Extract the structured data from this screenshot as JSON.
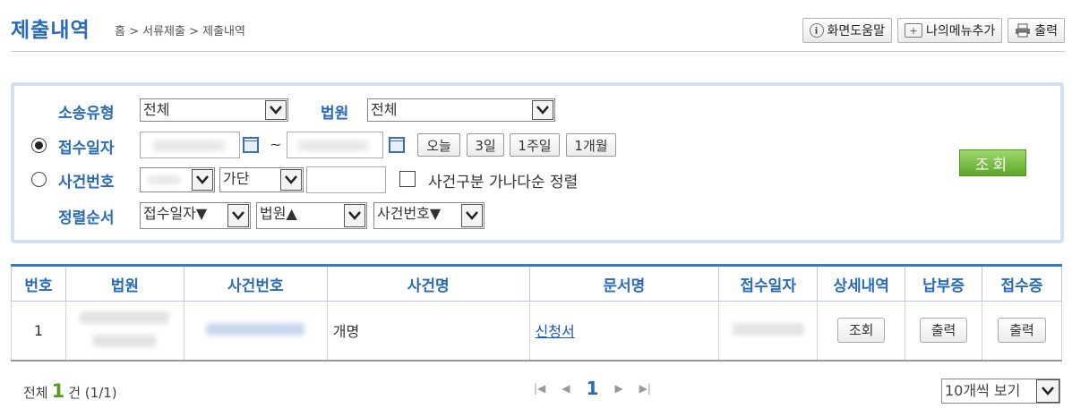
{
  "header": {
    "title": "제출내역",
    "breadcrumb": "홈 > 서류제출 > 제출내역",
    "buttons": {
      "help": "화면도움말",
      "add_menu": "나의메뉴추가",
      "print": "출력"
    }
  },
  "search": {
    "case_type_label": "소송유형",
    "case_type_value": "전체",
    "court_label": "법원",
    "court_value": "전체",
    "receipt_date_label": "접수일자",
    "date_separator": "~",
    "quick_buttons": [
      "오늘",
      "3일",
      "1주일",
      "1개월"
    ],
    "case_number_label": "사건번호",
    "case_kind_value": "가단",
    "sort_checkbox_label": "사건구분 가나다순 정렬",
    "sort_order_label": "정렬순서",
    "sort_options": [
      "접수일자▼",
      "법원▲",
      "사건번호▼"
    ],
    "submit_button": "조회",
    "selected_radio": "접수일자"
  },
  "table": {
    "headers": [
      "번호",
      "법원",
      "사건번호",
      "사건명",
      "문서명",
      "접수일자",
      "상세내역",
      "납부증",
      "접수증"
    ],
    "rows": [
      {
        "no": "1",
        "case_name": "개명",
        "doc_name": "신청서",
        "detail_btn": "조회",
        "payment_btn": "출력",
        "receipt_btn": "출력"
      }
    ]
  },
  "footer": {
    "total_prefix": "전체",
    "total_count": "1",
    "total_suffix": "건 (1/1)",
    "current_page": "1",
    "per_page": "10개씩 보기"
  },
  "colors": {
    "accent": "#2a6bb8",
    "submit": "#6cb33a",
    "count": "#5a9c1d"
  }
}
